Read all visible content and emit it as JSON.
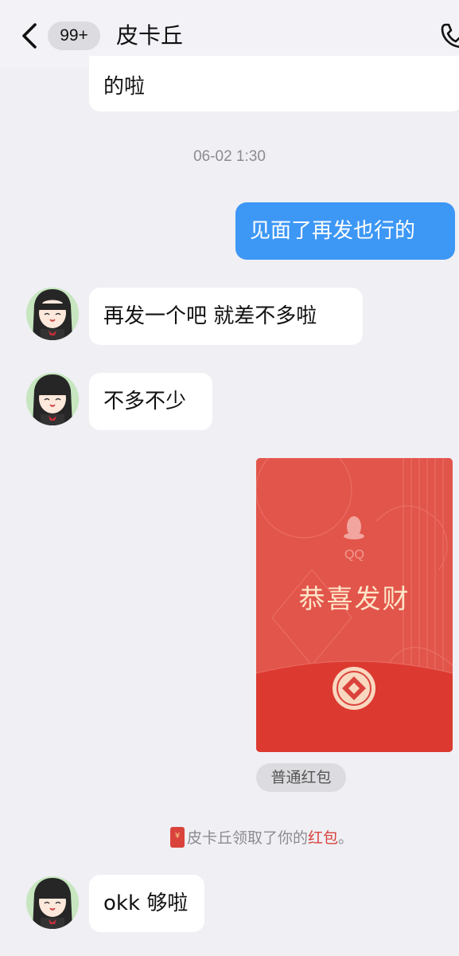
{
  "header": {
    "back_icon": "chevron-left-icon",
    "unread_badge": "99+",
    "contact_name": "皮卡丘",
    "call_icon": "phone-icon"
  },
  "messages": {
    "m0": {
      "text": "的啦",
      "direction": "incoming"
    },
    "timestamp": "06-02 1:30",
    "m1": {
      "text": "见面了再发也行的",
      "direction": "outgoing"
    },
    "m2": {
      "text": "再发一个吧 就差不多啦",
      "direction": "incoming"
    },
    "m3": {
      "text": "不多不少",
      "direction": "incoming"
    },
    "red_packet": {
      "brand": "QQ",
      "greeting": "恭喜发财",
      "type_label": "普通红包",
      "direction": "outgoing"
    },
    "system_notice": {
      "icon": "red-packet-icon",
      "icon_glyph": "¥",
      "prefix": "皮卡丘领取了你的",
      "link": "红包",
      "suffix": "。"
    },
    "m4": {
      "text": "okk 够啦",
      "direction": "incoming"
    }
  },
  "colors": {
    "background": "#efeff4",
    "outgoing_bubble": "#3d97f5",
    "incoming_bubble": "#ffffff",
    "red_packet": "#e2554b",
    "red_packet_bottom": "#dc3a31",
    "link_red": "#d9433c"
  }
}
